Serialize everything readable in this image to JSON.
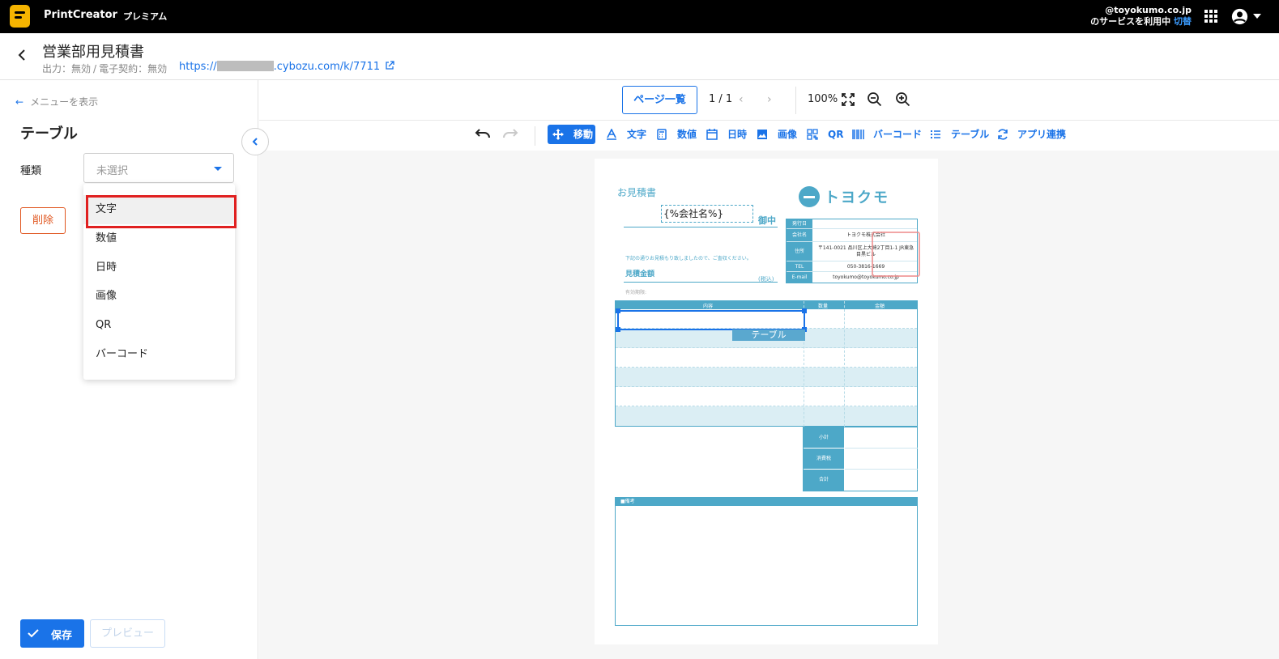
{
  "topbar": {
    "app_name": "PrintCreator",
    "plan": "プレミアム",
    "account_domain": "@toyokumo.co.jp",
    "service_text": "のサービスを利用中",
    "switch_label": "切替",
    "accent": "#3b9cff"
  },
  "header": {
    "title": "営業部用見積書",
    "output_label": "出力：無効",
    "esign_label": "電子契約：無効",
    "url_prefix": "https://",
    "url_suffix": ".cybozu.com/k/7711"
  },
  "left_panel": {
    "show_menu": "メニューを表示",
    "title": "テーブル",
    "kind_label": "種類",
    "kind_placeholder": "未選択",
    "delete_label": "削除",
    "save_label": "保存",
    "preview_label": "プレビュー"
  },
  "dropdown": {
    "options": [
      "文字",
      "数値",
      "日時",
      "画像",
      "QR",
      "バーコード"
    ],
    "highlighted": "文字"
  },
  "view_bar": {
    "page_list_label": "ページ一覧",
    "page_indicator": "1 / 1",
    "zoom": "100%"
  },
  "tools": {
    "move": "移動",
    "text": "文字",
    "number": "数値",
    "datetime": "日時",
    "image": "画像",
    "qr": "QR",
    "barcode": "バーコード",
    "table": "テーブル",
    "app_link": "アプリ連携"
  },
  "paper": {
    "title": "お見積書",
    "company_field": "{%会社名%}",
    "onchu": "御中",
    "logo_text": "トヨクモ",
    "note": "下記の通りお見積もり致しましたので、ご査収ください。",
    "amount_label": "見積金額",
    "tax_label": "(税込)",
    "valid_label": "有効期限:",
    "info_rows": [
      {
        "k": "発行日",
        "v": ""
      },
      {
        "k": "会社名",
        "v": "トヨクモ株式会社"
      },
      {
        "k": "住所",
        "v": "〒141-0021 品川区上大崎2丁目1-1 JR東急目黒ビル"
      },
      {
        "k": "TEL",
        "v": "050-3816-1669"
      },
      {
        "k": "E-mail",
        "v": "toyokumo@toyokumo.co.jp"
      }
    ],
    "table_head": {
      "content": "内容",
      "qty": "数量",
      "amount": "金額"
    },
    "table_tag": "テーブル",
    "subtotal": "小計",
    "consumption_tax": "消費税",
    "total": "合計",
    "remarks": "■備考"
  }
}
